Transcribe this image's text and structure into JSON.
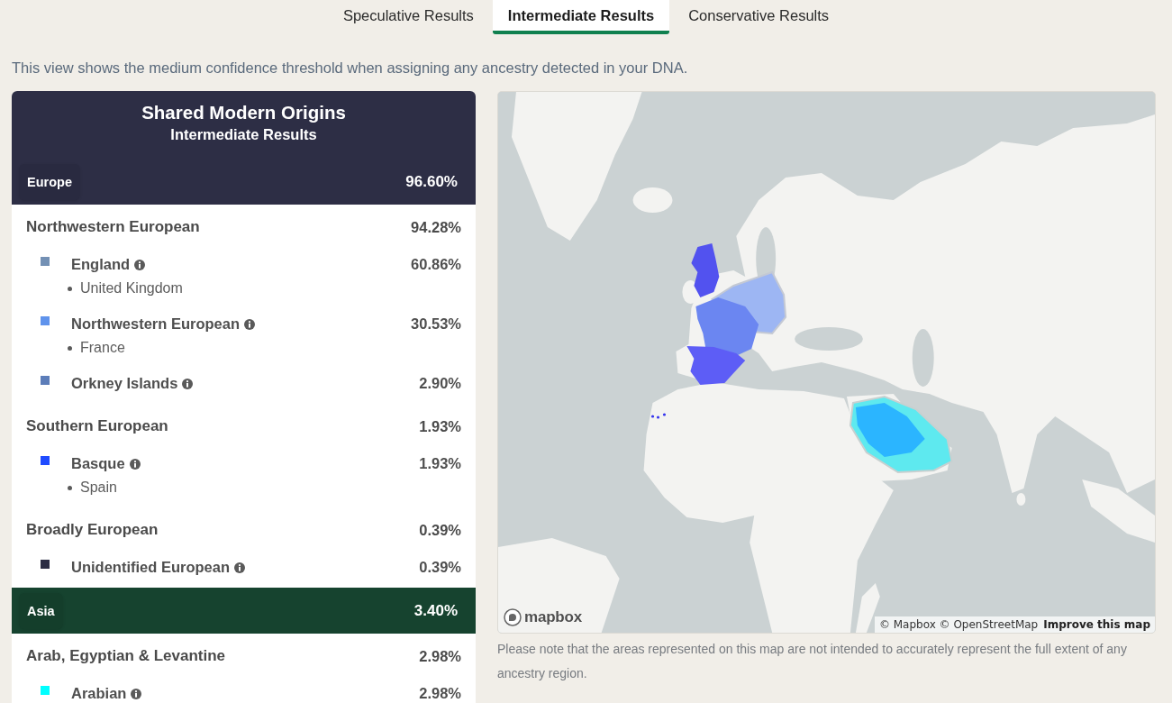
{
  "tabs": [
    {
      "label": "Speculative Results",
      "selected": false
    },
    {
      "label": "Intermediate Results",
      "selected": true
    },
    {
      "label": "Conservative Results",
      "selected": false
    }
  ],
  "description": "This view shows the medium confidence threshold when assigning any ancestry detected in your DNA.",
  "results_panel": {
    "title": "Shared Modern Origins",
    "subtitle": "Intermediate Results",
    "regions": [
      {
        "name": "Europe",
        "percent": "96.60%",
        "color": "#2d2e45",
        "groups": [
          {
            "name": "Northwestern European",
            "percent": "94.28%",
            "populations": [
              {
                "name": "England",
                "percent": "60.86%",
                "color": "#7390b4",
                "locations": [
                  "United Kingdom"
                ]
              },
              {
                "name": "Northwestern European",
                "percent": "30.53%",
                "color": "#5f93ec",
                "locations": [
                  "France"
                ]
              },
              {
                "name": "Orkney Islands",
                "percent": "2.90%",
                "color": "#5c7db9"
              }
            ]
          },
          {
            "name": "Southern European",
            "percent": "1.93%",
            "populations": [
              {
                "name": "Basque",
                "percent": "1.93%",
                "color": "#1f4bff",
                "locations": [
                  "Spain"
                ]
              }
            ]
          },
          {
            "name": "Broadly European",
            "percent": "0.39%",
            "populations": [
              {
                "name": "Unidentified European",
                "percent": "0.39%",
                "color": "#2c2d44"
              }
            ]
          }
        ]
      },
      {
        "name": "Asia",
        "percent": "3.40%",
        "color": "#16432f",
        "groups": [
          {
            "name": "Arab, Egyptian & Levantine",
            "percent": "2.98%",
            "populations": [
              {
                "name": "Arabian",
                "percent": "2.98%",
                "color": "#00ffff"
              }
            ]
          }
        ]
      }
    ]
  },
  "map": {
    "logo_text": "mapbox",
    "attribution": "© Mapbox © OpenStreetMap",
    "improve_link": "Improve this map"
  },
  "map_note": "Please note that the areas represented on this map are not intended to accurately represent the full extent of any ancestry region."
}
